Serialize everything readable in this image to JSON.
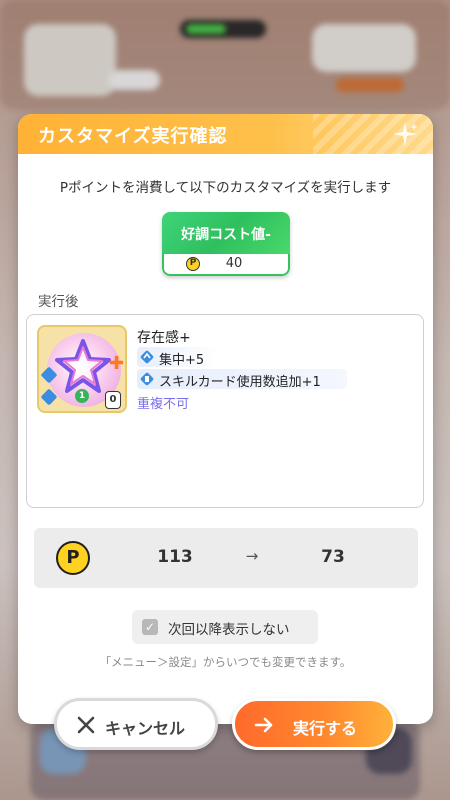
{
  "dialog": {
    "title": "カスタマイズ実行確認",
    "subtitle": "Pポイントを消費して以下のカスタマイズを実行します",
    "skill_card": {
      "name": "好調コスト値-",
      "coin_symbol": "P",
      "cost": "40"
    },
    "after_label": "実行後",
    "result": {
      "card_name": "存在感+",
      "card_badge_one": "1",
      "card_badge_zero": "0",
      "effects": [
        {
          "icon": "concentration-icon",
          "text": "集中+5"
        },
        {
          "icon": "skill-card-icon",
          "text": "スキルカード使用数追加+1"
        }
      ],
      "no_stack": "重複不可"
    },
    "points": {
      "coin_symbol": "P",
      "before": "113",
      "arrow": "→",
      "after": "73"
    },
    "checkbox": {
      "checked": true,
      "label": "次回以降表示しない"
    },
    "hint": "「メニュー＞設定」からいつでも変更できます。"
  },
  "buttons": {
    "cancel_label": "キャンセル",
    "confirm_label": "実行する"
  },
  "colors": {
    "title_bar": "#ffb236",
    "confirm": "#ff6a2b",
    "skill_card": "#3fd47a",
    "coin": "#ffd21f",
    "no_stack_text": "#7b6ff0"
  }
}
